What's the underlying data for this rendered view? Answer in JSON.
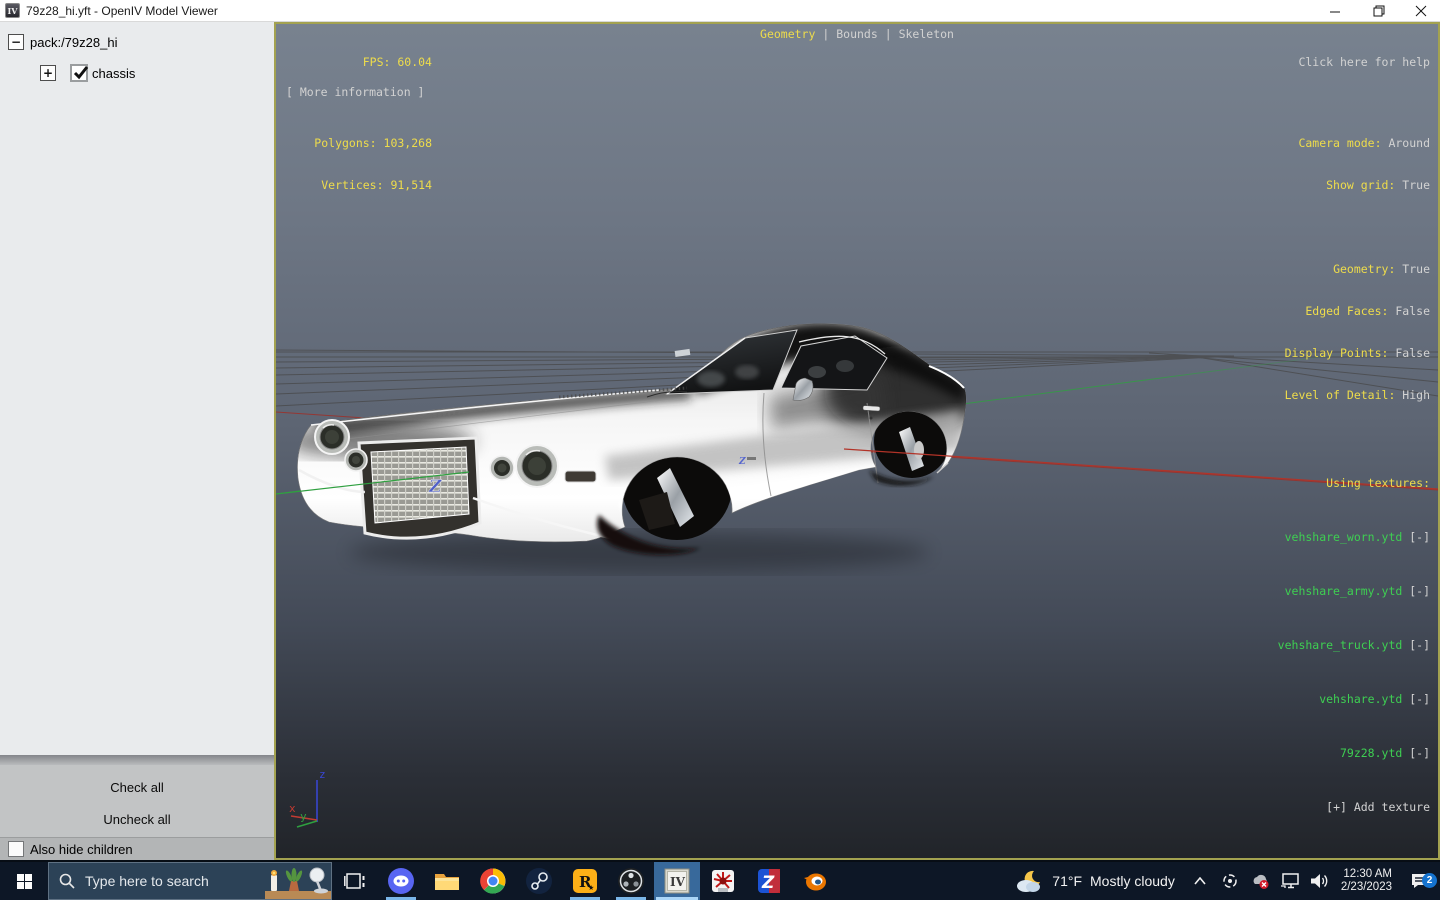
{
  "window": {
    "title": "79z28_hi.yft - OpenIV Model Viewer",
    "icon_text": "IV"
  },
  "sidebar": {
    "root_label": "pack:/79z28_hi",
    "root_expander": "−",
    "child_expander": "+",
    "child_label": "chassis",
    "check_all": "Check all",
    "uncheck_all": "Uncheck all",
    "also_hide_children": "Also hide children"
  },
  "viewport": {
    "stats": {
      "fps": "FPS: 60.04",
      "polygons": "Polygons: 103,268",
      "vertices": "Vertices: 91,514",
      "more_info": "[ More information ]"
    },
    "tabs": {
      "geometry": "Geometry",
      "bounds": "Bounds",
      "skeleton": "Skeleton",
      "separator": "|"
    },
    "help": "Click here for help",
    "camera": [
      {
        "label": "Camera mode:",
        "value": " Around"
      },
      {
        "label": "Show grid:",
        "value": " True"
      }
    ],
    "display": [
      {
        "label": "Geometry:",
        "value": " True"
      },
      {
        "label": "Edged Faces:",
        "value": " False"
      },
      {
        "label": "Display Points:",
        "value": " False"
      },
      {
        "label": "Level of Detail:",
        "value": " High"
      }
    ],
    "textures": {
      "header": "Using textures:",
      "items": [
        "vehshare_worn.ytd",
        "vehshare_army.ytd",
        "vehshare_truck.ytd",
        "vehshare.ytd",
        "79z28.ytd"
      ],
      "remove_glyph": " [-]",
      "add_label": "[+] Add texture"
    },
    "axis": {
      "x": "x",
      "y": "y",
      "z": "z"
    },
    "colors": {
      "overlay_yellow": "#eedc4b",
      "overlay_green": "#3ecf52",
      "overlay_light": "#d2d2d2"
    }
  },
  "taskbar": {
    "search_placeholder": "Type here to search",
    "weather": {
      "temp": "71°F",
      "condition": "Mostly cloudy"
    },
    "clock": {
      "time": "12:30 AM",
      "date": "2/23/2023"
    },
    "notifications_badge": "2"
  }
}
